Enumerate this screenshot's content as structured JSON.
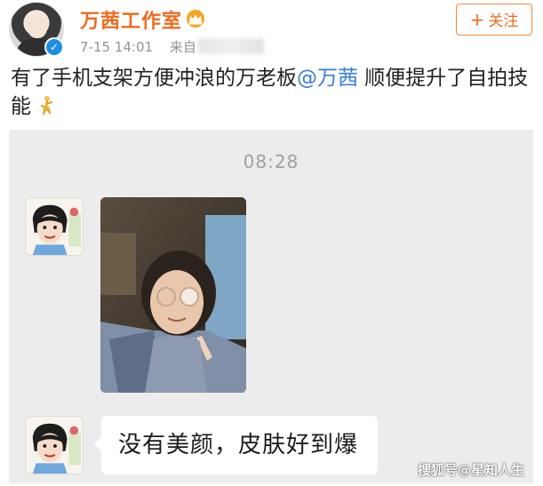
{
  "header": {
    "account_name": "万茜工作室",
    "time": "7-15 14:01",
    "source_label": "来自",
    "follow_label": "关注",
    "follow_plus": "+"
  },
  "post": {
    "text_before": "有了手机支架方便冲浪的万老板",
    "mention": "@万茜",
    "text_after": " 顺便提升了自拍技能"
  },
  "chat": {
    "time": "08:28",
    "message": "没有美颜，皮肤好到爆"
  },
  "watermark": "搜狐号@星知人生",
  "colors": {
    "brand_orange": "#f06a1e",
    "mention_blue": "#3a7bd5",
    "verify_blue": "#1d8fe1",
    "chat_background": "#ececec"
  },
  "icons": {
    "verify": "verified-badge-icon",
    "crown": "crown-icon",
    "dancer": "dancer-emoji-icon",
    "plus": "plus-icon"
  }
}
